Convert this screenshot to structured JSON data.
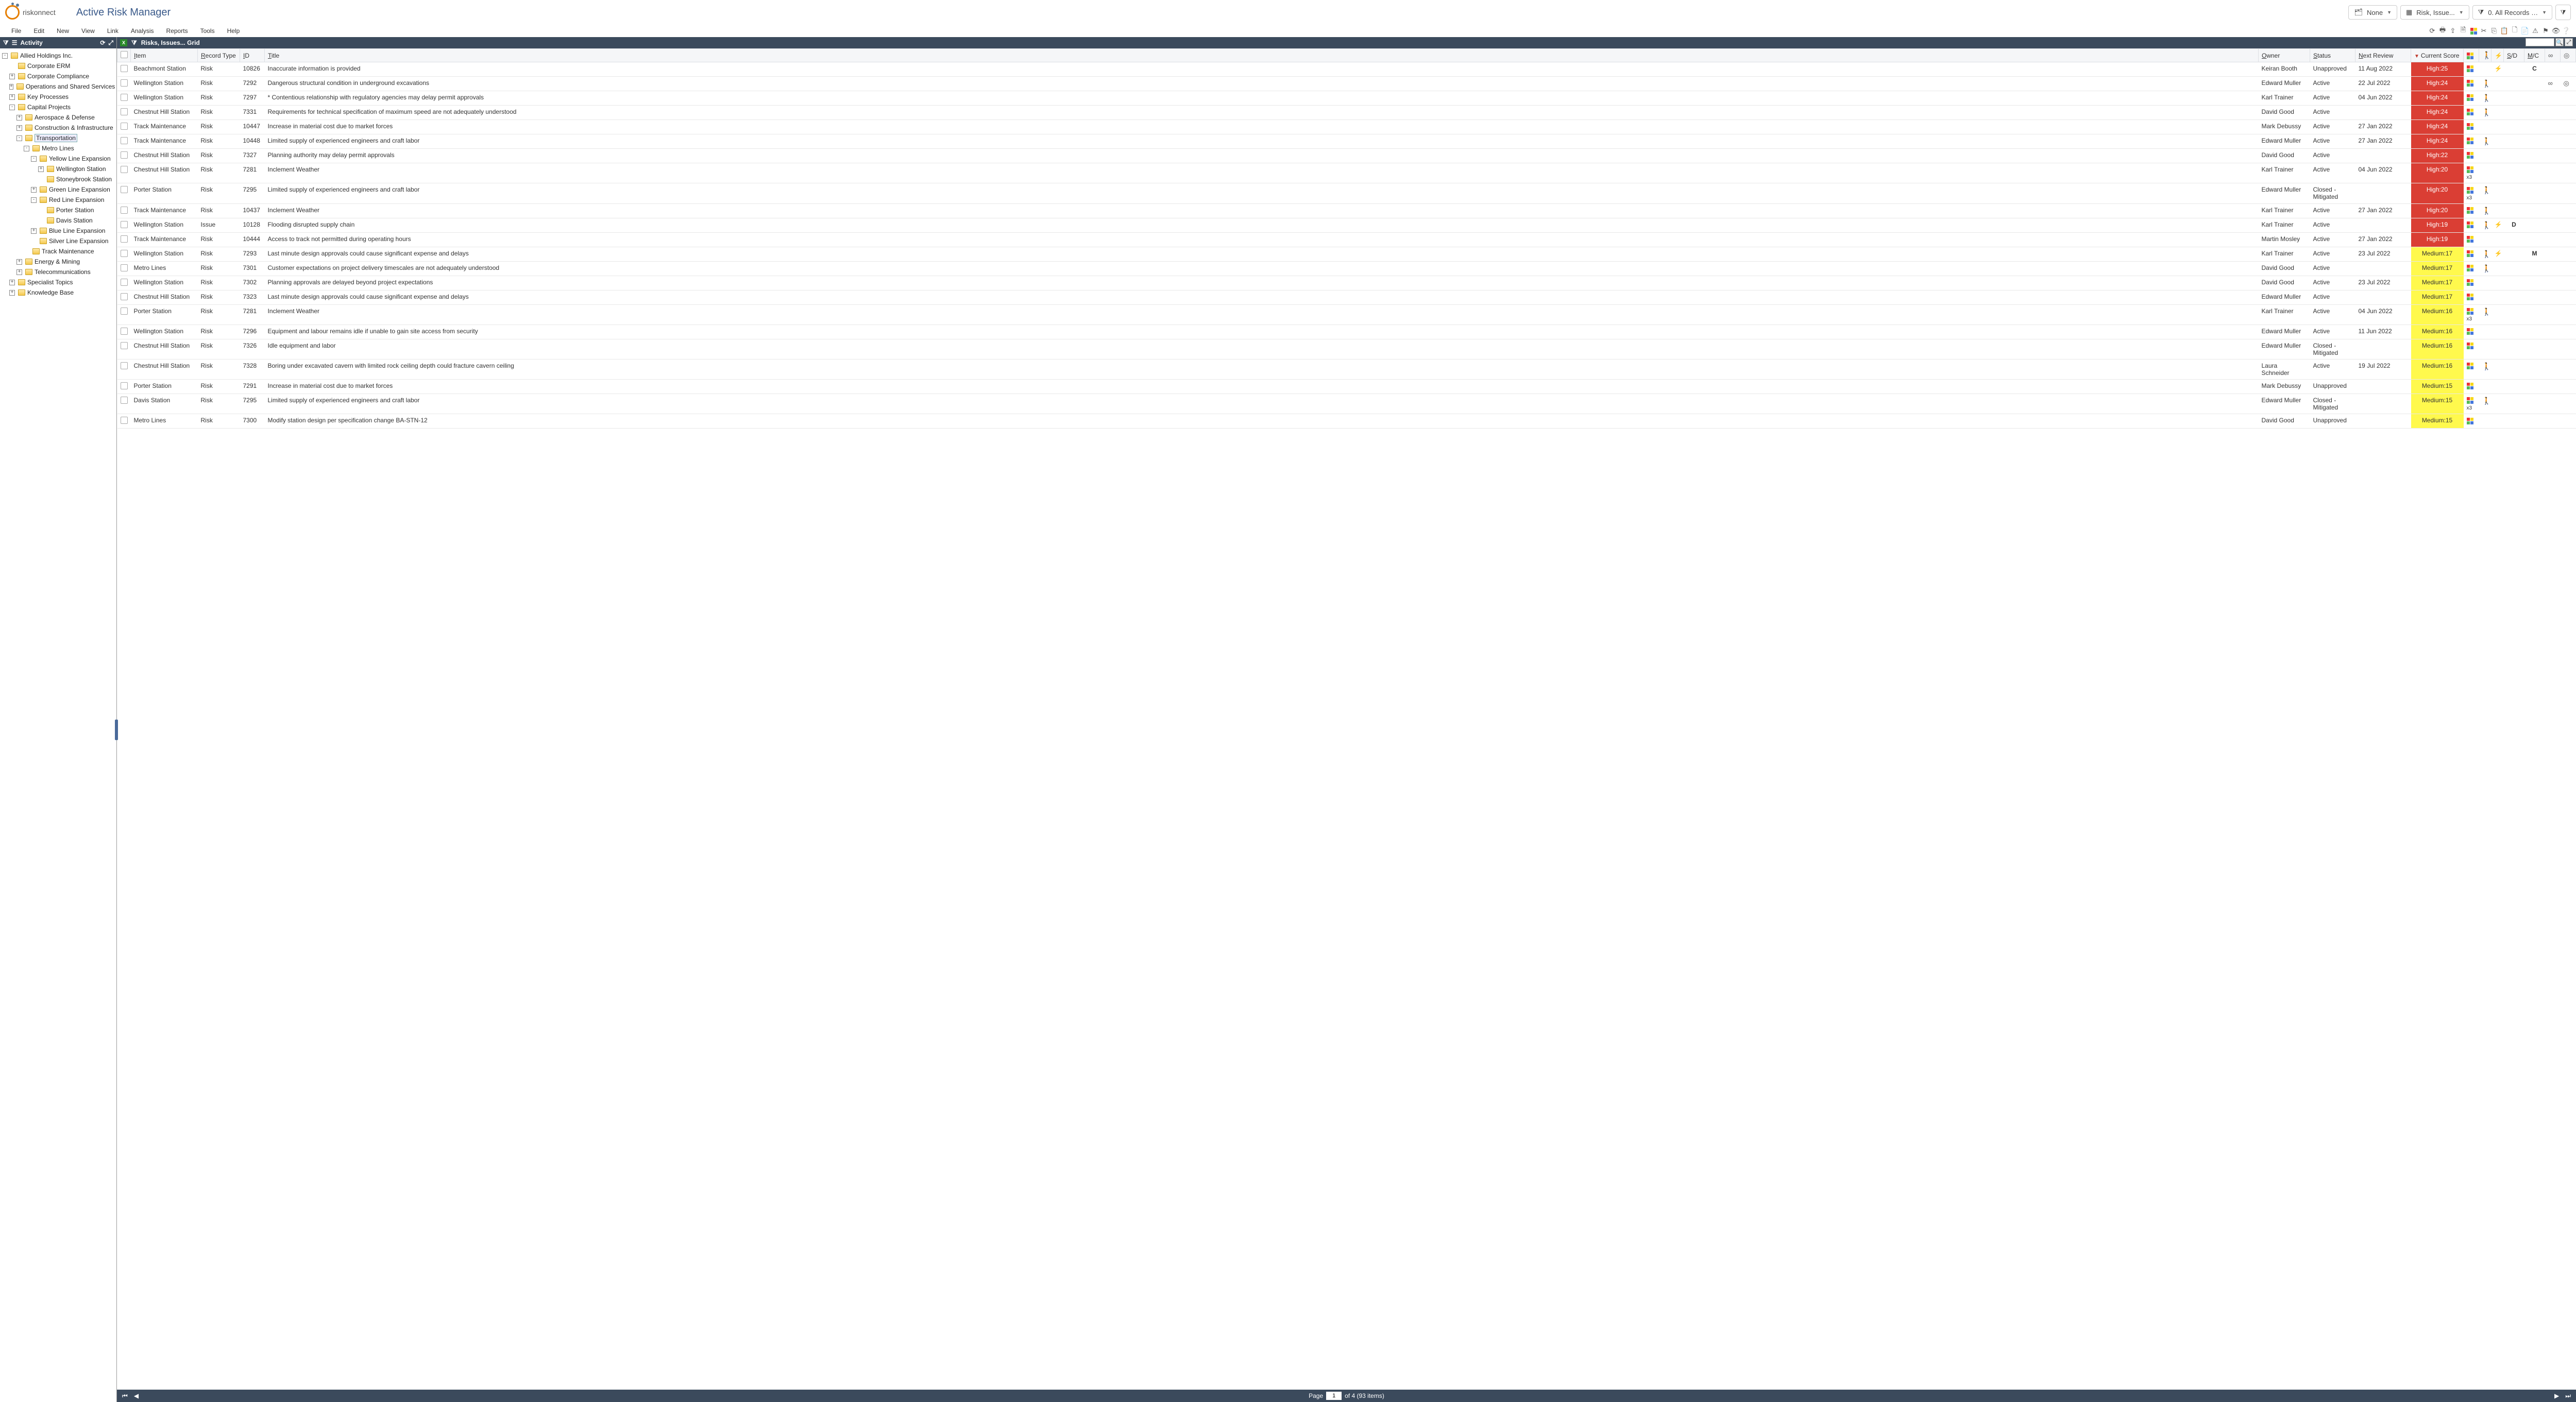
{
  "brand": {
    "name": "riskonnect",
    "app_title": "Active Risk Manager"
  },
  "header_controls": {
    "layers_label": "None",
    "grid_label": "Risk, Issue...",
    "filter_label": "0. All Records …"
  },
  "menu": [
    "File",
    "Edit",
    "New",
    "View",
    "Link",
    "Analysis",
    "Reports",
    "Tools",
    "Help"
  ],
  "sidebar": {
    "title": "Activity",
    "tree": [
      {
        "ind": 0,
        "exp": "-",
        "label": "Allied Holdings Inc."
      },
      {
        "ind": 1,
        "exp": " ",
        "label": "Corporate ERM"
      },
      {
        "ind": 1,
        "exp": "+",
        "label": "Corporate Compliance"
      },
      {
        "ind": 1,
        "exp": "+",
        "label": "Operations and Shared Services"
      },
      {
        "ind": 1,
        "exp": "+",
        "label": "Key Processes"
      },
      {
        "ind": 1,
        "exp": "-",
        "label": "Capital Projects"
      },
      {
        "ind": 2,
        "exp": "+",
        "label": "Aerospace & Defense"
      },
      {
        "ind": 2,
        "exp": "+",
        "label": "Construction & Infrastructure"
      },
      {
        "ind": 2,
        "exp": "-",
        "label": "Transportation",
        "sel": true
      },
      {
        "ind": 3,
        "exp": "-",
        "label": "Metro Lines"
      },
      {
        "ind": 4,
        "exp": "-",
        "label": "Yellow Line Expansion"
      },
      {
        "ind": 5,
        "exp": "+",
        "label": "Wellington Station"
      },
      {
        "ind": 5,
        "exp": " ",
        "label": "Stoneybrook Station"
      },
      {
        "ind": 4,
        "exp": "+",
        "label": "Green Line Expansion"
      },
      {
        "ind": 4,
        "exp": "-",
        "label": "Red Line Expansion"
      },
      {
        "ind": 5,
        "exp": " ",
        "label": "Porter Station"
      },
      {
        "ind": 5,
        "exp": " ",
        "label": "Davis Station"
      },
      {
        "ind": 4,
        "exp": "+",
        "label": "Blue Line Expansion"
      },
      {
        "ind": 4,
        "exp": " ",
        "label": "Silver Line Expansion"
      },
      {
        "ind": 3,
        "exp": " ",
        "label": "Track Maintenance"
      },
      {
        "ind": 2,
        "exp": "+",
        "label": "Energy & Mining"
      },
      {
        "ind": 2,
        "exp": "+",
        "label": "Telecommunications"
      },
      {
        "ind": 1,
        "exp": "+",
        "label": "Specialist Topics"
      },
      {
        "ind": 1,
        "exp": "+",
        "label": "Knowledge Base"
      }
    ]
  },
  "grid": {
    "title": "Risks, Issues... Grid",
    "columns": [
      "",
      "Item",
      "Record Type",
      "ID",
      "Title",
      "Owner",
      "Status",
      "Next Review",
      "Current Score",
      "",
      "",
      "",
      "S/D",
      "M/C",
      "",
      ""
    ],
    "col_icons": {
      "9": "grid",
      "10": "walk",
      "11": "bolt",
      "14": "inf",
      "15": "target"
    },
    "rows": [
      {
        "item": "Beachmont Station",
        "rt": "Risk",
        "id": "10826",
        "title": "Inaccurate information is provided",
        "owner": "Keiran Booth",
        "status": "Unapproved",
        "next": "11 Aug 2022",
        "score": "High:25",
        "sc": "high",
        "g": true,
        "walk": false,
        "bolt": true,
        "sd": "",
        "mc": "C",
        "inf": false,
        "tgt": false
      },
      {
        "item": "Wellington Station",
        "rt": "Risk",
        "id": "7292",
        "title": "Dangerous structural condition in underground excavations",
        "owner": "Edward Muller",
        "status": "Active",
        "next": "22 Jul 2022",
        "score": "High:24",
        "sc": "high",
        "g": true,
        "walk": true,
        "bolt": false,
        "sd": "",
        "mc": "",
        "inf": true,
        "tgt": true
      },
      {
        "item": "Wellington Station",
        "rt": "Risk",
        "id": "7297",
        "title": "* Contentious relationship with regulatory agencies may delay permit approvals",
        "owner": "Karl Trainer",
        "status": "Active",
        "next": "04 Jun 2022",
        "score": "High:24",
        "sc": "high",
        "g": true,
        "walk": true,
        "bolt": false,
        "sd": "",
        "mc": "",
        "inf": false,
        "tgt": false
      },
      {
        "item": "Chestnut Hill Station",
        "rt": "Risk",
        "id": "7331",
        "title": "Requirements for technical specification of maximum speed are not adequately understood",
        "owner": "David Good",
        "status": "Active",
        "next": "",
        "score": "High:24",
        "sc": "high",
        "g": true,
        "walk": true,
        "bolt": false,
        "sd": "",
        "mc": "",
        "inf": false,
        "tgt": false
      },
      {
        "item": "Track Maintenance",
        "rt": "Risk",
        "id": "10447",
        "title": "Increase in material cost due to market forces",
        "owner": "Mark Debussy",
        "status": "Active",
        "next": "27 Jan 2022",
        "score": "High:24",
        "sc": "high",
        "g": true,
        "walk": false,
        "bolt": false,
        "sd": "",
        "mc": "",
        "inf": false,
        "tgt": false
      },
      {
        "item": "Track Maintenance",
        "rt": "Risk",
        "id": "10448",
        "title": "Limited supply of experienced engineers and craft labor",
        "owner": "Edward Muller",
        "status": "Active",
        "next": "27 Jan 2022",
        "score": "High:24",
        "sc": "high",
        "g": true,
        "walk": true,
        "bolt": false,
        "sd": "",
        "mc": "",
        "inf": false,
        "tgt": false
      },
      {
        "item": "Chestnut Hill Station",
        "rt": "Risk",
        "id": "7327",
        "title": "Planning authority may delay permit approvals",
        "owner": "David Good",
        "status": "Active",
        "next": "",
        "score": "High:22",
        "sc": "high",
        "g": true,
        "walk": false,
        "bolt": false,
        "sd": "",
        "mc": "",
        "inf": false,
        "tgt": false
      },
      {
        "item": "Chestnut Hill Station",
        "rt": "Risk",
        "id": "7281",
        "title": "Inclement Weather",
        "owner": "Karl Trainer",
        "status": "Active",
        "next": "04 Jun 2022",
        "score": "High:20",
        "sc": "high",
        "g": true,
        "gx": "x3",
        "walk": false,
        "bolt": false,
        "sd": "",
        "mc": "",
        "inf": false,
        "tgt": false
      },
      {
        "item": "Porter Station",
        "rt": "Risk",
        "id": "7295",
        "title": "Limited supply of experienced engineers and craft labor",
        "owner": "Edward Muller",
        "status": "Closed - Mitigated",
        "next": "",
        "score": "High:20",
        "sc": "high",
        "g": true,
        "gx": "x3",
        "walk": true,
        "bolt": false,
        "sd": "",
        "mc": "",
        "inf": false,
        "tgt": false
      },
      {
        "item": "Track Maintenance",
        "rt": "Risk",
        "id": "10437",
        "title": "Inclement Weather",
        "owner": "Karl Trainer",
        "status": "Active",
        "next": "27 Jan 2022",
        "score": "High:20",
        "sc": "high",
        "g": true,
        "walk": true,
        "bolt": false,
        "sd": "",
        "mc": "",
        "inf": false,
        "tgt": false
      },
      {
        "item": "Wellington Station",
        "rt": "Issue",
        "id": "10128",
        "title": "Flooding disrupted supply chain",
        "owner": "Karl Trainer",
        "status": "Active",
        "next": "",
        "score": "High:19",
        "sc": "high",
        "g": true,
        "walk": true,
        "bolt": true,
        "sd": "D",
        "mc": "",
        "inf": false,
        "tgt": false
      },
      {
        "item": "Track Maintenance",
        "rt": "Risk",
        "id": "10444",
        "title": "Access to track not permitted during operating hours",
        "owner": "Martin Mosley",
        "status": "Active",
        "next": "27 Jan 2022",
        "score": "High:19",
        "sc": "high",
        "g": true,
        "walk": false,
        "bolt": false,
        "sd": "",
        "mc": "",
        "inf": false,
        "tgt": false
      },
      {
        "item": "Wellington Station",
        "rt": "Risk",
        "id": "7293",
        "title": "Last minute design approvals could cause significant expense and delays",
        "owner": "Karl Trainer",
        "status": "Active",
        "next": "23 Jul 2022",
        "score": "Medium:17",
        "sc": "med",
        "g": true,
        "walk": true,
        "bolt": true,
        "sd": "",
        "mc": "M",
        "inf": false,
        "tgt": false
      },
      {
        "item": "Metro Lines",
        "rt": "Risk",
        "id": "7301",
        "title": "Customer expectations on project delivery timescales are not adequately understood",
        "owner": "David Good",
        "status": "Active",
        "next": "",
        "score": "Medium:17",
        "sc": "med",
        "g": true,
        "walk": true,
        "bolt": false,
        "sd": "",
        "mc": "",
        "inf": false,
        "tgt": false
      },
      {
        "item": "Wellington Station",
        "rt": "Risk",
        "id": "7302",
        "title": "Planning approvals are delayed beyond project expectations",
        "owner": "David Good",
        "status": "Active",
        "next": "23 Jul 2022",
        "score": "Medium:17",
        "sc": "med",
        "g": true,
        "walk": false,
        "bolt": false,
        "sd": "",
        "mc": "",
        "inf": false,
        "tgt": false
      },
      {
        "item": "Chestnut Hill Station",
        "rt": "Risk",
        "id": "7323",
        "title": "Last minute design approvals could cause significant expense and delays",
        "owner": "Edward Muller",
        "status": "Active",
        "next": "",
        "score": "Medium:17",
        "sc": "med",
        "g": true,
        "walk": false,
        "bolt": false,
        "sd": "",
        "mc": "",
        "inf": false,
        "tgt": false
      },
      {
        "item": "Porter Station",
        "rt": "Risk",
        "id": "7281",
        "title": "Inclement Weather",
        "owner": "Karl Trainer",
        "status": "Active",
        "next": "04 Jun 2022",
        "score": "Medium:16",
        "sc": "med",
        "g": true,
        "gx": "x3",
        "walk": true,
        "bolt": false,
        "sd": "",
        "mc": "",
        "inf": false,
        "tgt": false
      },
      {
        "item": "Wellington Station",
        "rt": "Risk",
        "id": "7296",
        "title": "Equipment and labour remains idle if unable to gain site access from security",
        "owner": "Edward Muller",
        "status": "Active",
        "next": "11 Jun 2022",
        "score": "Medium:16",
        "sc": "med",
        "g": true,
        "walk": false,
        "bolt": false,
        "sd": "",
        "mc": "",
        "inf": false,
        "tgt": false
      },
      {
        "item": "Chestnut Hill Station",
        "rt": "Risk",
        "id": "7326",
        "title": "Idle equipment and labor",
        "owner": "Edward Muller",
        "status": "Closed - Mitigated",
        "next": "",
        "score": "Medium:16",
        "sc": "med",
        "g": true,
        "walk": false,
        "bolt": false,
        "sd": "",
        "mc": "",
        "inf": false,
        "tgt": false
      },
      {
        "item": "Chestnut Hill Station",
        "rt": "Risk",
        "id": "7328",
        "title": "Boring under excavated cavern with limited rock ceiling depth could fracture cavern ceiling",
        "owner": "Laura Schneider",
        "status": "Active",
        "next": "19 Jul 2022",
        "score": "Medium:16",
        "sc": "med",
        "g": true,
        "walk": true,
        "bolt": false,
        "sd": "",
        "mc": "",
        "inf": false,
        "tgt": false
      },
      {
        "item": "Porter Station",
        "rt": "Risk",
        "id": "7291",
        "title": "Increase in material cost due to market forces",
        "owner": "Mark Debussy",
        "status": "Unapproved",
        "next": "",
        "score": "Medium:15",
        "sc": "med",
        "g": true,
        "walk": false,
        "bolt": false,
        "sd": "",
        "mc": "",
        "inf": false,
        "tgt": false
      },
      {
        "item": "Davis Station",
        "rt": "Risk",
        "id": "7295",
        "title": "Limited supply of experienced engineers and craft labor",
        "owner": "Edward Muller",
        "status": "Closed - Mitigated",
        "next": "",
        "score": "Medium:15",
        "sc": "med",
        "g": true,
        "gx": "x3",
        "walk": true,
        "bolt": false,
        "sd": "",
        "mc": "",
        "inf": false,
        "tgt": false
      },
      {
        "item": "Metro Lines",
        "rt": "Risk",
        "id": "7300",
        "title": "Modify station design per specification change BA-STN-12",
        "owner": "David Good",
        "status": "Unapproved",
        "next": "",
        "score": "Medium:15",
        "sc": "med",
        "g": true,
        "walk": false,
        "bolt": false,
        "sd": "",
        "mc": "",
        "inf": false,
        "tgt": false
      }
    ]
  },
  "footer": {
    "page_label": "Page",
    "page": "1",
    "of_label": "of 4  (93 items)"
  }
}
